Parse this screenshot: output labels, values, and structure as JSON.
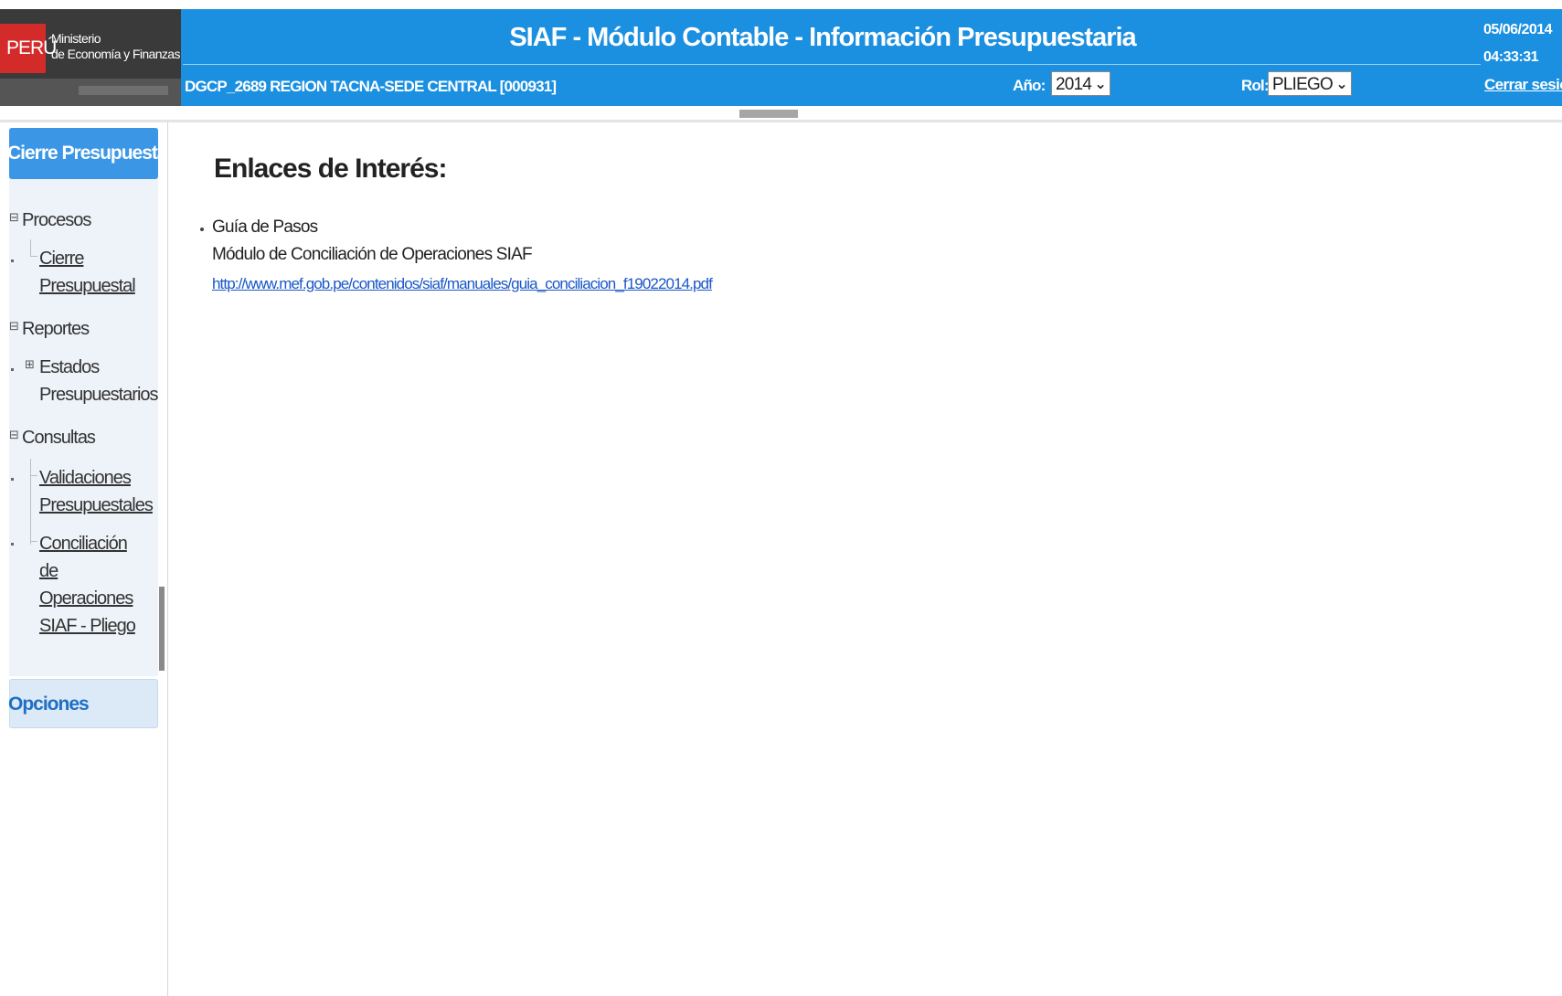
{
  "header": {
    "country": "PERÚ",
    "ministry_line1": "Ministerio",
    "ministry_line2": "de Economía y Finanzas",
    "title": "SIAF - Módulo Contable - Información Presupuestaria",
    "entity": "DGCP_2689  REGION TACNA-SEDE CENTRAL  [000931]",
    "year_label": "Año:",
    "year_value": "2014",
    "role_label": "Rol:",
    "role_value": "PLIEGO",
    "date": "05/06/2014",
    "time": "04:33:31",
    "logout": "Cerrar sesión"
  },
  "sidebar": {
    "panel_title": "Cierre Presupuestal",
    "sections": [
      {
        "label": "Procesos",
        "items": [
          {
            "lines": [
              "Cierre",
              "Presupuestal"
            ]
          }
        ]
      },
      {
        "label": "Reportes",
        "items": [
          {
            "lines": [
              "Estados",
              "Presupuestarios"
            ]
          }
        ]
      },
      {
        "label": "Consultas",
        "items": [
          {
            "lines": [
              "Validaciones",
              "Presupuestales"
            ]
          },
          {
            "lines": [
              "Conciliación",
              "de",
              "Operaciones",
              "SIAF - Pliego"
            ]
          }
        ]
      }
    ],
    "options_title": "Opciones"
  },
  "main": {
    "title": "Enlaces de Interés:",
    "links": [
      {
        "name": "Guía de Pasos",
        "description": "Módulo de Conciliación de Operaciones SIAF",
        "url": "http://www.mef.gob.pe/contenidos/siaf/manuales/guia_conciliacion_f19022014.pdf"
      }
    ]
  },
  "colors": {
    "header_blue": "#1b8fe0",
    "panel_blue": "#3b97e6",
    "link_blue": "#1a57c7",
    "peru_red": "#d32a2a"
  }
}
